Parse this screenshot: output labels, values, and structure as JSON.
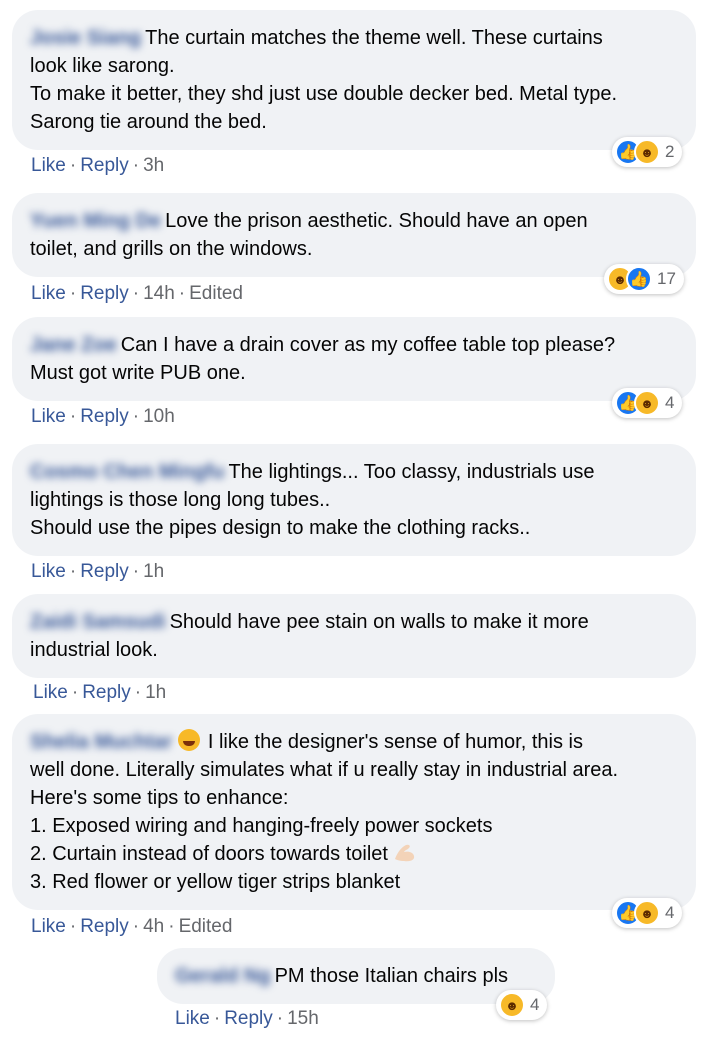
{
  "comments": [
    {
      "author": "Josie Siang",
      "lines": [
        "The curtain matches the theme well. These curtains",
        "look like sarong.",
        "To make it better, they shd just use double decker bed. Metal type.",
        "Sarong tie around the bed."
      ],
      "like": "Like",
      "reply": "Reply",
      "time": "3h",
      "edited": "",
      "reactions": [
        "like-icon",
        "haha-icon"
      ],
      "reaction_count": "2"
    },
    {
      "author": "Yuen Ming De",
      "lines": [
        "Love the prison aesthetic. Should have an open",
        "toilet, and grills on the windows."
      ],
      "like": "Like",
      "reply": "Reply",
      "time": "14h",
      "edited": "Edited",
      "reactions": [
        "haha-icon",
        "like-icon"
      ],
      "reaction_count": "17"
    },
    {
      "author": "Jane Zoe",
      "lines": [
        "Can I have a drain cover as my coffee table top please?",
        "Must got write PUB one."
      ],
      "like": "Like",
      "reply": "Reply",
      "time": "10h",
      "edited": "",
      "reactions": [
        "like-icon",
        "haha-icon"
      ],
      "reaction_count": "4"
    },
    {
      "author": "Cosmo Chen Mingfu",
      "lines": [
        "The lightings... Too classy, industrials use",
        "lightings is those long long tubes..",
        "Should use the pipes design to make the clothing racks.."
      ],
      "like": "Like",
      "reply": "Reply",
      "time": "1h",
      "edited": "",
      "reactions": [],
      "reaction_count": ""
    },
    {
      "author": "Zaidi Samsudi",
      "lines": [
        "Should have pee stain on walls to make it more",
        "industrial look."
      ],
      "like": "Like",
      "reply": "Reply",
      "time": "1h",
      "edited": "",
      "reactions": [],
      "reaction_count": ""
    },
    {
      "author": "Shelia Muchtar",
      "lines": [
        "I like the designer's sense of humor, this is",
        "well done. Literally simulates what if u really stay in industrial area.",
        "Here's some tips to enhance:",
        "1. Exposed wiring and hanging-freely power sockets",
        "2. Curtain instead of doors towards toilet",
        "3. Red flower or yellow tiger strips blanket"
      ],
      "like": "Like",
      "reply": "Reply",
      "time": "4h",
      "edited": "Edited",
      "reactions": [
        "like-icon",
        "haha-icon"
      ],
      "reaction_count": "4"
    },
    {
      "author": "Gerald Ng",
      "lines": [
        "PM those Italian chairs pls"
      ],
      "like": "Like",
      "reply": "Reply",
      "time": "15h",
      "edited": "",
      "reactions": [
        "haha-icon"
      ],
      "reaction_count": "4"
    }
  ]
}
